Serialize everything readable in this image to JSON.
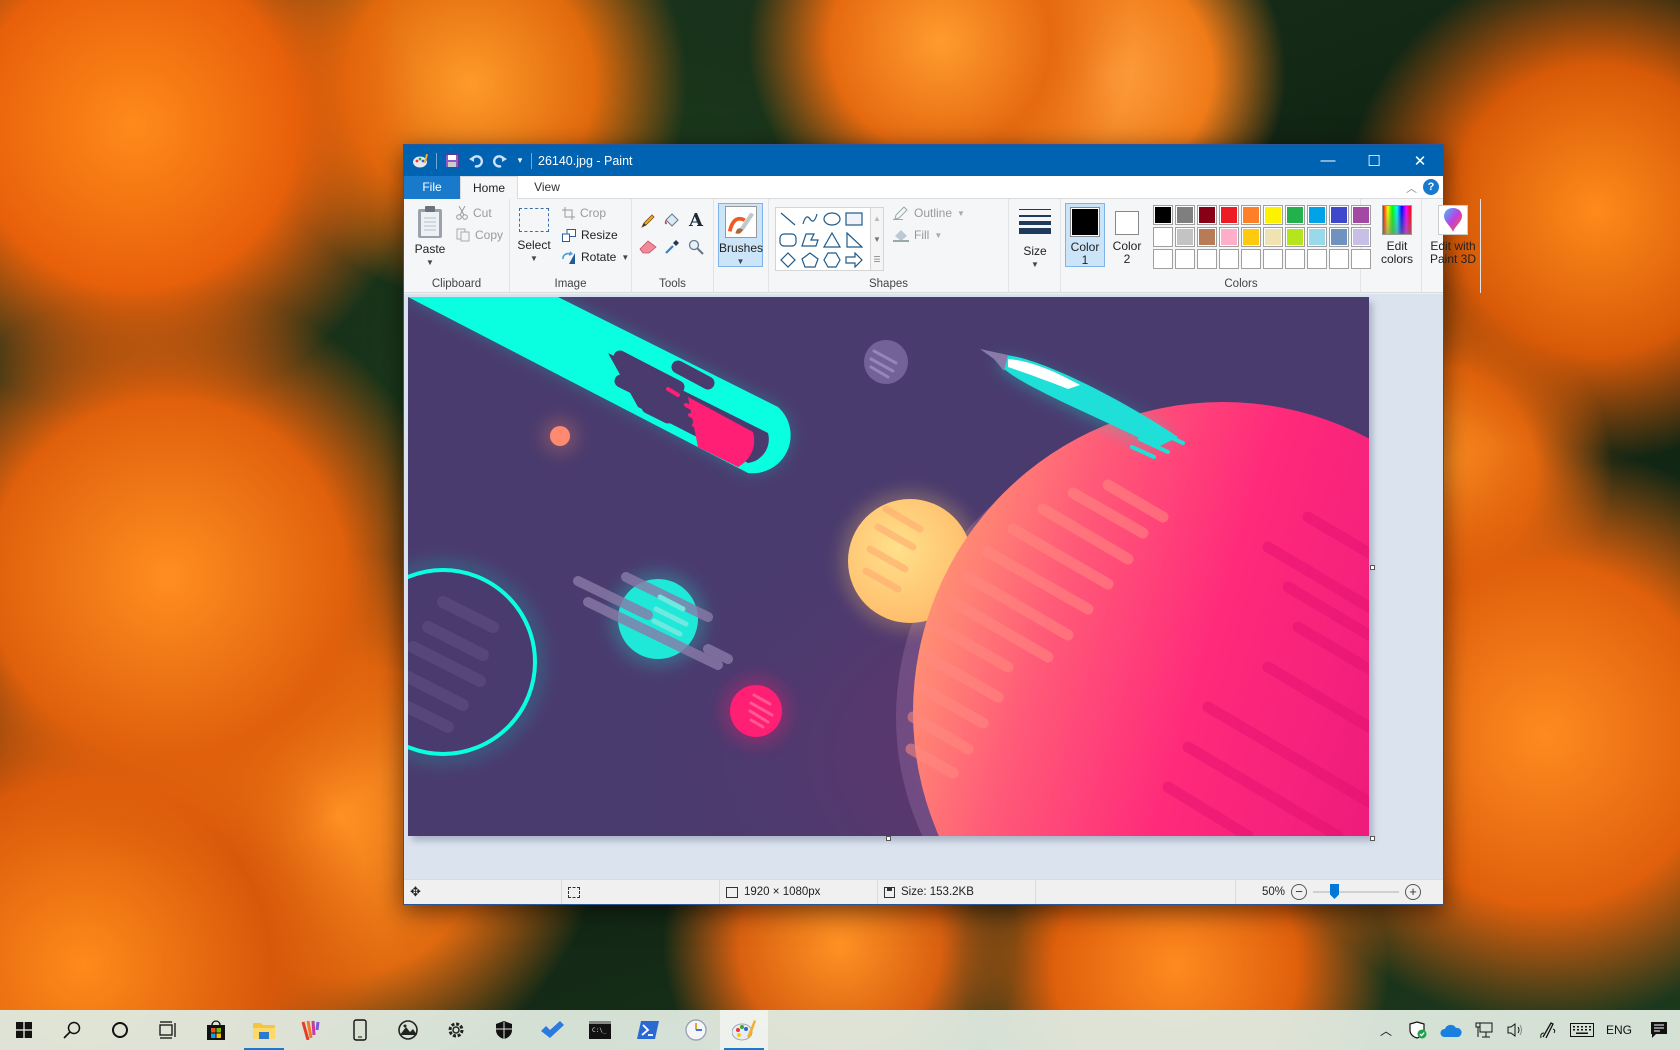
{
  "window": {
    "title": "26140.jpg - Paint",
    "qat_icons": [
      "paint-app-icon",
      "save-icon",
      "undo-icon",
      "redo-icon",
      "customize-qat-icon"
    ],
    "controls": {
      "minimize": "—",
      "maximize": "☐",
      "close": "✕"
    }
  },
  "tabs": [
    {
      "label": "File",
      "active": false
    },
    {
      "label": "Home",
      "active": true
    },
    {
      "label": "View",
      "active": false
    }
  ],
  "help_label": "?",
  "ribbon": {
    "clipboard": {
      "label": "Clipboard",
      "paste": "Paste",
      "cut": "Cut",
      "copy": "Copy"
    },
    "image": {
      "label": "Image",
      "select": "Select",
      "crop": "Crop",
      "resize": "Resize",
      "rotate": "Rotate"
    },
    "tools": {
      "label": "Tools",
      "items": [
        "pencil",
        "fill-bucket",
        "text",
        "eraser",
        "color-picker",
        "magnifier"
      ],
      "text_glyph": "A"
    },
    "brushes": {
      "label": "Brushes"
    },
    "shapes": {
      "label": "Shapes",
      "outline": "Outline",
      "fill": "Fill",
      "items": [
        "line",
        "curve",
        "oval",
        "rectangle",
        "rounded-rectangle",
        "polygon",
        "triangle",
        "right-triangle",
        "diamond",
        "pentagon",
        "hexagon",
        "right-arrow"
      ]
    },
    "size": {
      "label": "Size"
    },
    "colors": {
      "label": "Colors",
      "color1": {
        "label": "Color",
        "num": "1",
        "value": "#000000"
      },
      "color2": {
        "label": "Color",
        "num": "2",
        "value": "#ffffff"
      },
      "palette_row1": [
        "#000000",
        "#7f7f7f",
        "#880015",
        "#ed1c24",
        "#ff7f27",
        "#fff200",
        "#22b14c",
        "#00a2e8",
        "#3f48cc",
        "#a349a4"
      ],
      "palette_row2": [
        "#ffffff",
        "#c3c3c3",
        "#b97a57",
        "#ffaec9",
        "#ffc90e",
        "#efe4b0",
        "#b5e61d",
        "#99d9ea",
        "#7092be",
        "#c8bfe7"
      ],
      "palette_row3": [
        "",
        "",
        "",
        "",
        "",
        "",
        "",
        "",
        "",
        ""
      ],
      "edit_colors_1": "Edit",
      "edit_colors_2": "colors"
    },
    "paint3d": {
      "line1": "Edit with",
      "line2": "Paint 3D"
    }
  },
  "status": {
    "dimensions": "1920 × 1080px",
    "size": "Size: 153.2KB",
    "zoom": "50%",
    "zoom_value_percent": 50,
    "zoom_minus": "−",
    "zoom_plus": "+"
  },
  "taskbar": {
    "items": [
      "start",
      "search",
      "cortana",
      "task-view",
      "store",
      "file-explorer",
      "app-stripes",
      "phone",
      "photos",
      "settings",
      "security",
      "todo",
      "terminal",
      "powershell",
      "clock",
      "paint"
    ],
    "active": [
      "file-explorer",
      "paint"
    ],
    "tray": {
      "language": "ENG"
    }
  }
}
